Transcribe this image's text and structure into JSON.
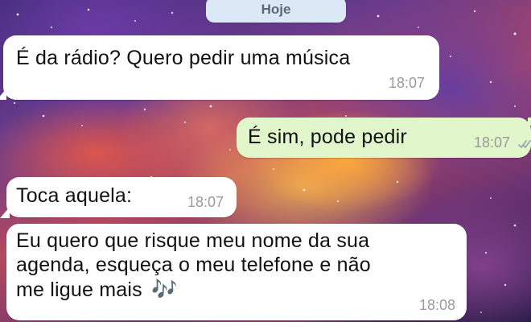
{
  "date_divider": {
    "label": "Hoje"
  },
  "messages": [
    {
      "text": "É da rádio? Quero pedir uma música",
      "time": "18:07",
      "direction": "incoming"
    },
    {
      "text": "É sim, pode pedir",
      "time": "18:07",
      "direction": "outgoing",
      "status_icon": "double-check-icon"
    },
    {
      "text": "Toca aquela:",
      "time": "18:07",
      "direction": "incoming"
    },
    {
      "text_lines": [
        "Eu quero que risque meu nome da sua",
        "agenda, esqueça o meu telefone e não",
        "me ligue mais"
      ],
      "emoji": "🎶",
      "time": "18:08",
      "direction": "incoming"
    }
  ],
  "colors": {
    "incoming_bubble": "#ffffff",
    "outgoing_bubble": "#e1f7cb",
    "time_text": "#9a9a9a",
    "date_pill": "#dbe8f6"
  }
}
